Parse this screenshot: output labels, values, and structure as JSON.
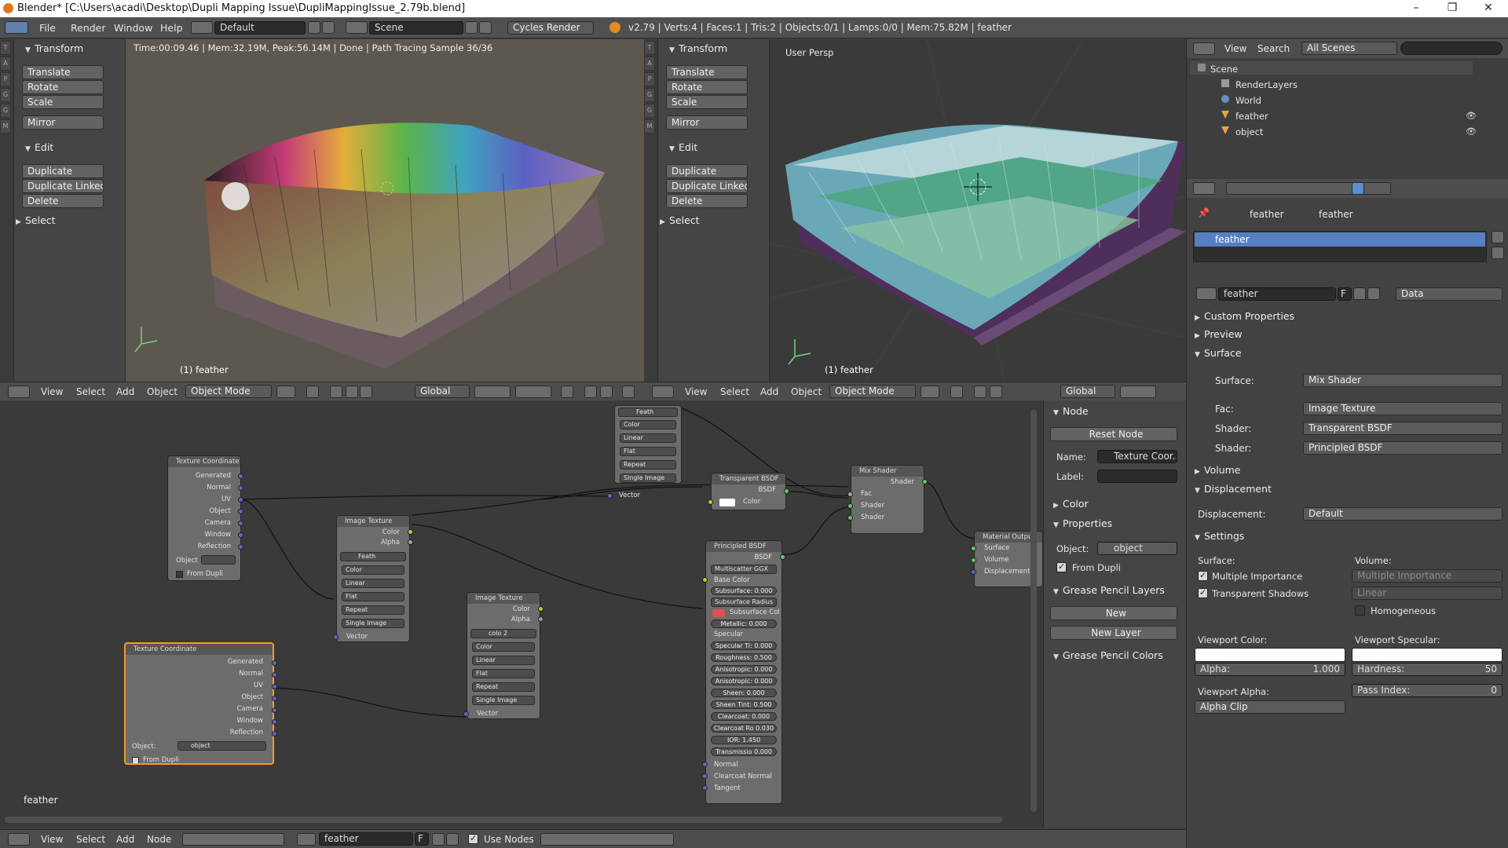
{
  "window": {
    "title": "Blender* [C:\\Users\\acadi\\Desktop\\Dupli Mapping Issue\\DupliMappingIssue_2.79b.blend]",
    "minimize": "–",
    "maximize": "❐",
    "close": "✕"
  },
  "infobar": {
    "menus": [
      "File",
      "Render",
      "Window",
      "Help"
    ],
    "layout": "Default",
    "scene": "Scene",
    "engine": "Cycles Render",
    "stats": "v2.79 | Verts:4 | Faces:1 | Tris:2 | Objects:0/1 | Lamps:0/0 | Mem:75.82M | feather"
  },
  "toolshelf": {
    "transform": "Transform",
    "translate": "Translate",
    "rotate": "Rotate",
    "scale": "Scale",
    "mirror": "Mirror",
    "edit": "Edit",
    "duplicate": "Duplicate",
    "duplicate_linked": "Duplicate Linked",
    "delete": "Delete",
    "select": "Select",
    "tabs": [
      "T",
      "A",
      "P",
      "G",
      "G",
      "M"
    ]
  },
  "viewport_left": {
    "render_info": "Time:00:09.46 | Mem:32.19M, Peak:56.14M | Done | Path Tracing Sample 36/36",
    "object_label": "(1) feather"
  },
  "viewport_right": {
    "persp": "User Persp",
    "object_label": "(1) feather"
  },
  "view_header": {
    "view": "View",
    "select": "Select",
    "add": "Add",
    "object": "Object",
    "mode": "Object Mode",
    "orientation": "Global"
  },
  "outliner": {
    "view": "View",
    "search": "Search",
    "scenes": "All Scenes",
    "items": [
      "Scene",
      "RenderLayers",
      "World",
      "feather",
      "object"
    ]
  },
  "properties": {
    "breadcrumb": [
      "feather",
      "feather"
    ],
    "material_slot": "feather",
    "material_name": "feather",
    "material_f": "F",
    "data_select": "Data",
    "custom_properties": "Custom Properties",
    "preview": "Preview",
    "surface": "Surface",
    "surface_label": "Surface:",
    "surface_value": "Mix Shader",
    "fac_label": "Fac:",
    "fac_value": "Image Texture",
    "shader1_label": "Shader:",
    "shader1_value": "Transparent BSDF",
    "shader2_label": "Shader:",
    "shader2_value": "Principled BSDF",
    "volume": "Volume",
    "displacement": "Displacement",
    "displacement_label": "Displacement:",
    "displacement_value": "Default",
    "settings": "Settings",
    "surface_col": "Surface:",
    "volume_col": "Volume:",
    "multiple_importance": "Multiple Importance",
    "transparent_shadows": "Transparent Shadows",
    "vol_sampling": "Multiple Importance",
    "vol_interp": "Linear",
    "homogeneous": "Homogeneous",
    "viewport_color": "Viewport Color:",
    "viewport_specular": "Viewport Specular:",
    "alpha_label": "Alpha:",
    "alpha_value": "1.000",
    "hardness_label": "Hardness:",
    "hardness_value": "50",
    "viewport_alpha": "Viewport Alpha:",
    "alpha_clip": "Alpha Clip",
    "pass_index_label": "Pass Index:",
    "pass_index_value": "0"
  },
  "node_sidebar": {
    "node": "Node",
    "reset": "Reset Node",
    "name_label": "Name:",
    "name_value": "Texture Coor...",
    "label_label": "Label:",
    "label_value": "",
    "color": "Color",
    "properties": "Properties",
    "object_label": "Object:",
    "object_value": "object",
    "from_dupli": "From Dupli",
    "gp_layers": "Grease Pencil Layers",
    "new": "New",
    "new_layer": "New Layer",
    "gp_colors": "Grease Pencil Colors"
  },
  "node_editor": {
    "material_label": "feather",
    "tc1": {
      "title": "Texture Coordinate",
      "outputs": [
        "Generated",
        "Normal",
        "UV",
        "Object",
        "Camera",
        "Window",
        "Reflection"
      ],
      "object": "Object",
      "from_dupli": "From Dupli"
    },
    "tc2": {
      "title": "Texture Coordinate",
      "outputs": [
        "Generated",
        "Normal",
        "UV",
        "Object",
        "Camera",
        "Window",
        "Reflection"
      ],
      "object": "Object:",
      "object_value": "object",
      "from_dupli": "From Dupli"
    },
    "img_top": {
      "image": "Feath",
      "opts": [
        "Color",
        "Linear",
        "Flat",
        "Repeat",
        "Single Image"
      ],
      "vector": "Vector"
    },
    "img1": {
      "title": "Image Texture",
      "color": "Color",
      "alpha": "Alpha",
      "image": "Feath",
      "opts": [
        "Color",
        "Linear",
        "Flat",
        "Repeat",
        "Single Image"
      ],
      "vector": "Vector"
    },
    "img2": {
      "title": "Image Texture",
      "color": "Color",
      "alpha": "Alpha",
      "image": "colo",
      "users": "2",
      "opts": [
        "Color",
        "Linear",
        "Flat",
        "Repeat",
        "Single Image"
      ],
      "vector": "Vector"
    },
    "transparent": {
      "title": "Transparent BSDF",
      "bsdf": "BSDF",
      "color": "Color"
    },
    "mix": {
      "title": "Mix Shader",
      "shader_out": "Shader",
      "fac": "Fac",
      "shader1": "Shader",
      "shader2": "Shader"
    },
    "output": {
      "title": "Material Output",
      "surface": "Surface",
      "volume": "Volume",
      "displacement": "Displacement"
    },
    "principled": {
      "title": "Principled BSDF",
      "bsdf": "BSDF",
      "dist": "Multiscatter GGX",
      "base_color": "Base Color",
      "fields": [
        "Subsurface: 0.000",
        "Subsurface Radius",
        "Subsurface Col",
        "Metallic:      0.000",
        "Specular",
        "Specular Ti: 0.000",
        "Roughness: 0.500",
        "Anisotropic: 0.000",
        "Anisotropic: 0.000",
        "Sheen:       0.000",
        "Sheen Tint: 0.500",
        "Clearcoat:    0.000",
        "Clearcoat Ro 0.030",
        "IOR:          1.450",
        "Transmissio 0.000"
      ],
      "normal": "Normal",
      "clearcoat_normal": "Clearcoat Normal",
      "tangent": "Tangent"
    }
  },
  "node_header": {
    "view": "View",
    "select": "Select",
    "add": "Add",
    "node": "Node",
    "material": "feather",
    "f": "F",
    "use_nodes": "Use Nodes"
  }
}
